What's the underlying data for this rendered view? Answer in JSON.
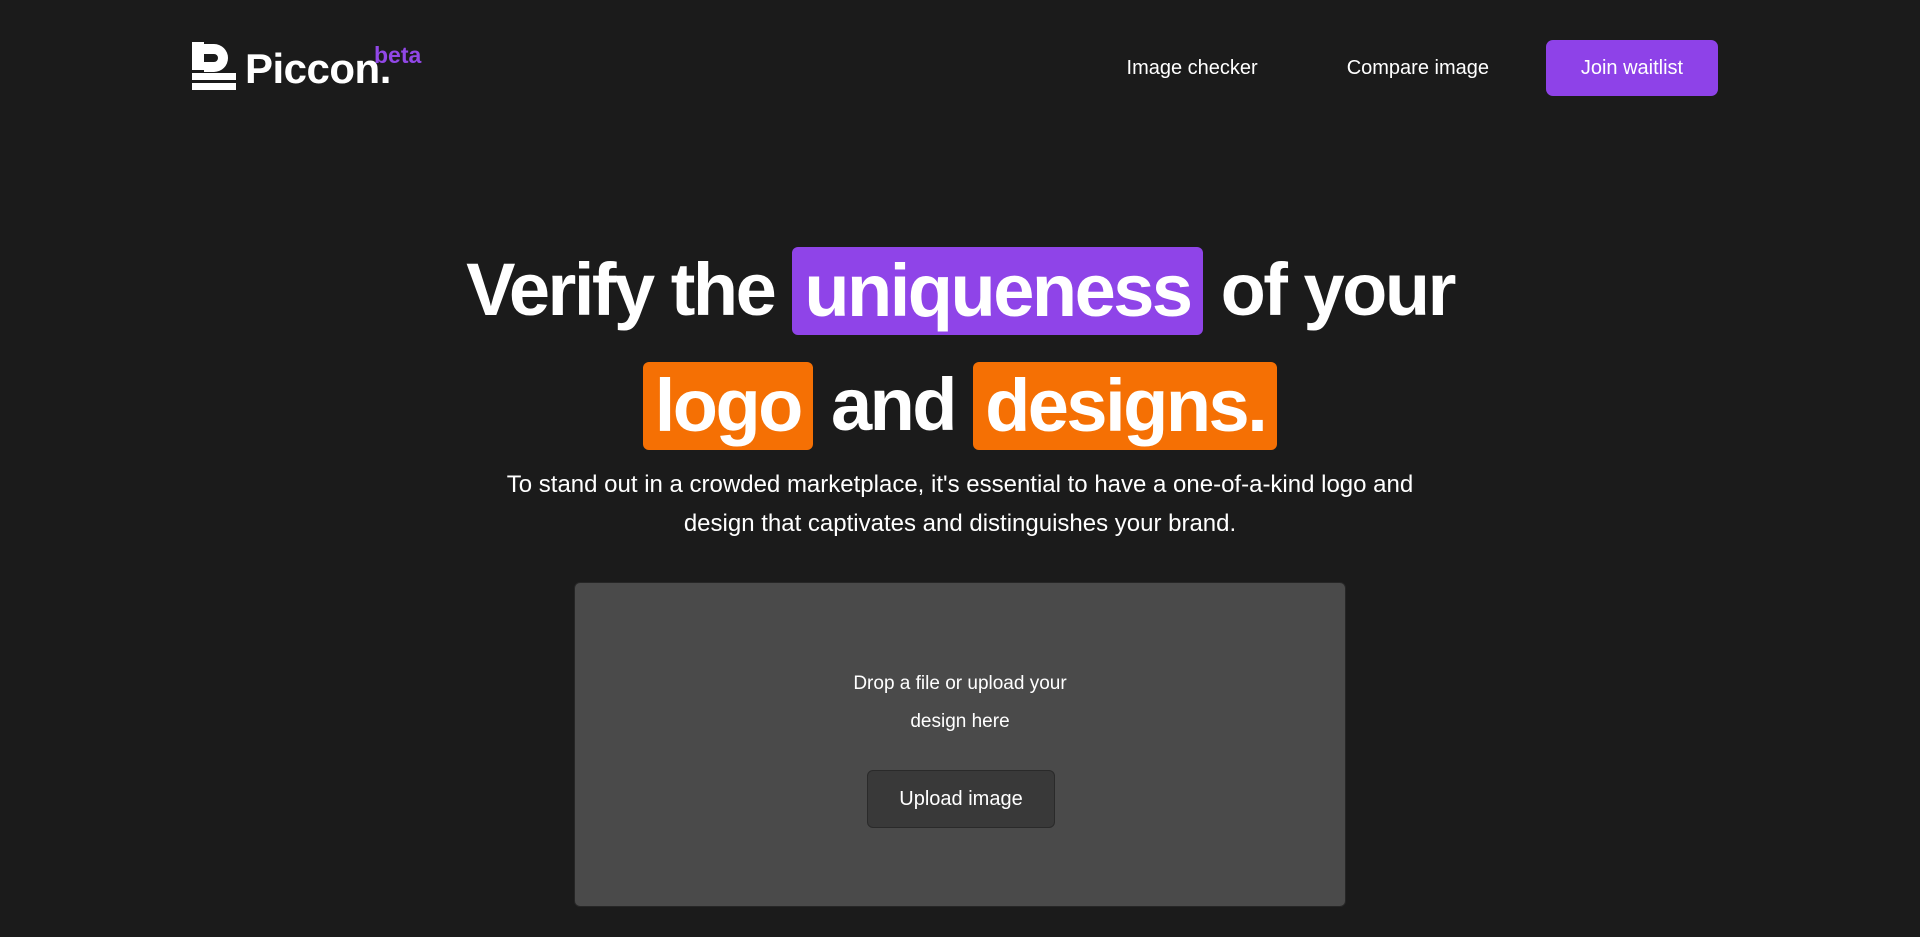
{
  "header": {
    "logo_text": "Piccon.",
    "logo_badge": "beta",
    "nav": [
      {
        "label": "Image checker"
      },
      {
        "label": "Compare image"
      }
    ],
    "cta_label": "Join waitlist"
  },
  "hero": {
    "line1": {
      "pre": "Verify the",
      "highlight": "uniqueness",
      "post": "of your"
    },
    "line2": {
      "highlight1": "logo",
      "mid": "and",
      "highlight2": "designs."
    },
    "subtitle_line1": "To stand out in a crowded marketplace, it's essential to have a one-of-a-kind logo and",
    "subtitle_line2": "design that captivates and distinguishes your brand."
  },
  "upload": {
    "prompt_line1": "Drop a file or upload your",
    "prompt_line2": "design here",
    "button_label": "Upload image"
  },
  "colors": {
    "background": "#1b1b1b",
    "accent_purple": "#8f44e8",
    "accent_orange": "#f57004",
    "dropzone": "#4a4a4a"
  }
}
